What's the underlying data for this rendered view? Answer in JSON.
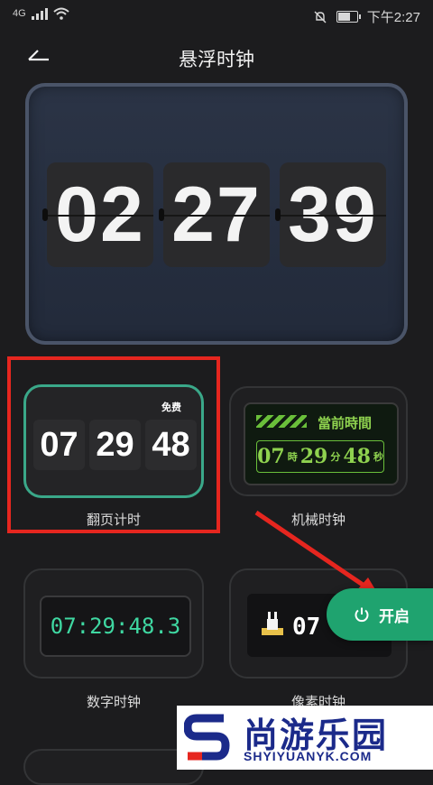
{
  "status_bar": {
    "network": "4G",
    "time": "下午2:27"
  },
  "header": {
    "title": "悬浮时钟",
    "back_icon": "back-arrow-icon"
  },
  "preview": {
    "hours": "02",
    "minutes": "27",
    "seconds": "39"
  },
  "styles": [
    {
      "label": "翻页计时",
      "badge": "免费",
      "hours": "07",
      "minutes": "29",
      "seconds": "48"
    },
    {
      "label": "机械时钟",
      "heading": "當前時間",
      "hours": "07",
      "h_unit": "時",
      "minutes": "29",
      "m_unit": "分",
      "seconds": "48",
      "s_unit": "秒"
    },
    {
      "label": "数字时钟",
      "time": "07:29:48.3"
    },
    {
      "label": "像素时钟",
      "time": "07"
    }
  ],
  "open_button": {
    "label": "开启",
    "icon": "power-icon"
  },
  "watermark": {
    "cn": "尚游乐园",
    "en": "SHYIYUANYK.COM"
  },
  "colors": {
    "accent": "#1fa36f",
    "highlight": "#e6261f",
    "digital": "#3fd8a2",
    "mech": "#8fd24f"
  }
}
